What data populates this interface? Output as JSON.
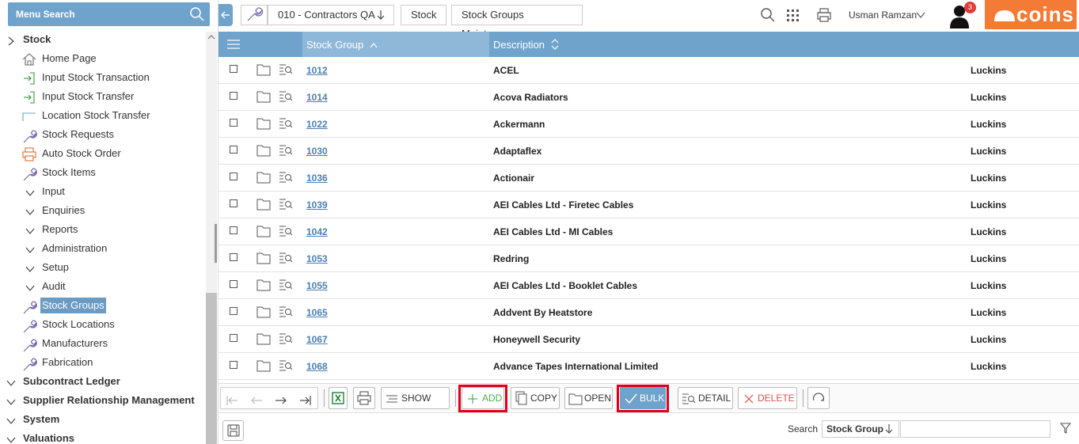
{
  "menu_search": {
    "label": "Menu Search"
  },
  "sidebar": {
    "items": [
      {
        "label": "Stock",
        "level": "top",
        "icon": "chevron-right"
      },
      {
        "label": "Home Page",
        "icon": "home-icon"
      },
      {
        "label": "Input Stock Transaction",
        "icon": "input-arrow-icon"
      },
      {
        "label": "Input Stock Transfer",
        "icon": "input-arrow-icon"
      },
      {
        "label": "Location Stock Transfer",
        "icon": "blank-icon"
      },
      {
        "label": "Stock Requests",
        "icon": "wrench-icon"
      },
      {
        "label": "Auto Stock Order",
        "icon": "printer-icon"
      },
      {
        "label": "Stock Items",
        "icon": "wrench-icon"
      },
      {
        "label": "Input",
        "icon": "chevron-down"
      },
      {
        "label": "Enquiries",
        "icon": "chevron-down"
      },
      {
        "label": "Reports",
        "icon": "chevron-down"
      },
      {
        "label": "Administration",
        "icon": "chevron-down"
      },
      {
        "label": "Setup",
        "icon": "chevron-down"
      },
      {
        "label": "Audit",
        "icon": "chevron-down"
      },
      {
        "label": "Stock Groups",
        "icon": "wrench-icon",
        "selected": true
      },
      {
        "label": "Stock Locations",
        "icon": "wrench-icon"
      },
      {
        "label": "Manufacturers",
        "icon": "wrench-icon"
      },
      {
        "label": "Fabrication",
        "icon": "wrench-icon"
      },
      {
        "label": "Subcontract Ledger",
        "level": "top",
        "icon": "chevron-down"
      },
      {
        "label": "Supplier Relationship Management",
        "level": "top",
        "icon": "chevron-down"
      },
      {
        "label": "System",
        "level": "top",
        "icon": "chevron-down"
      },
      {
        "label": "Valuations",
        "level": "top",
        "icon": "chevron-down"
      }
    ]
  },
  "breadcrumb": {
    "company": "010 - Contractors QA",
    "module": "Stock",
    "page": "Stock Groups Maintenance"
  },
  "header": {
    "user_name": "Usman Ramzan",
    "notification_count": "3",
    "brand": "COINS"
  },
  "grid": {
    "columns": [
      "Stock Group",
      "Description"
    ],
    "rows": [
      {
        "code": "1012",
        "description": "ACEL",
        "extra": "Luckins"
      },
      {
        "code": "1014",
        "description": "Acova Radiators",
        "extra": "Luckins"
      },
      {
        "code": "1022",
        "description": "Ackermann",
        "extra": "Luckins"
      },
      {
        "code": "1030",
        "description": "Adaptaflex",
        "extra": "Luckins"
      },
      {
        "code": "1036",
        "description": "Actionair",
        "extra": "Luckins"
      },
      {
        "code": "1039",
        "description": "AEI Cables Ltd - Firetec Cables",
        "extra": "Luckins"
      },
      {
        "code": "1042",
        "description": "AEI Cables Ltd - MI Cables",
        "extra": "Luckins"
      },
      {
        "code": "1053",
        "description": "Redring",
        "extra": "Luckins"
      },
      {
        "code": "1055",
        "description": "AEI Cables Ltd - Booklet Cables",
        "extra": "Luckins"
      },
      {
        "code": "1065",
        "description": "Addvent By Heatstore",
        "extra": "Luckins"
      },
      {
        "code": "1067",
        "description": "Honeywell Security",
        "extra": "Luckins"
      },
      {
        "code": "1068",
        "description": "Advance Tapes International Limited",
        "extra": "Luckins"
      }
    ]
  },
  "toolbar": {
    "show_all": "SHOW ALL",
    "add": "ADD",
    "copy": "COPY",
    "open": "OPEN",
    "bulk": "BULK",
    "detail": "DETAIL",
    "delete": "DELETE"
  },
  "footer": {
    "search_label": "Search",
    "search_field": "Stock Group",
    "search_value": ""
  },
  "colors": {
    "header_blue": "#6fa3cc",
    "brand_orange": "#f37b35",
    "highlight_red": "#e0001a",
    "link_blue": "#4a7fb5"
  }
}
